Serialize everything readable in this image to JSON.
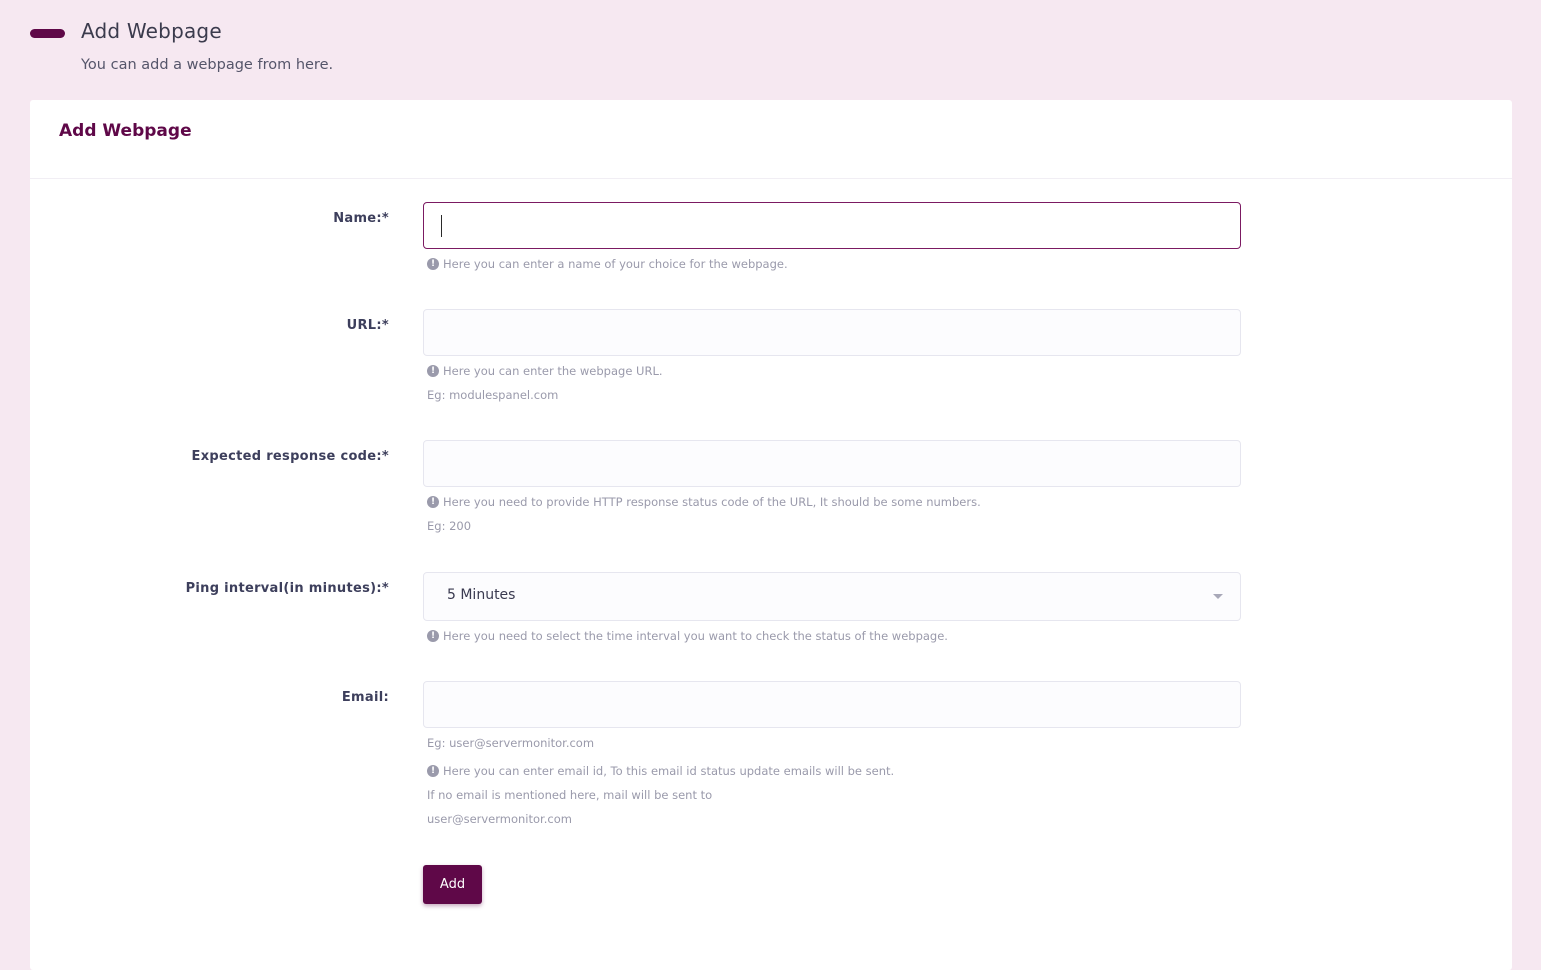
{
  "page_header": {
    "title": "Add Webpage",
    "subtitle": "You can add a webpage from here."
  },
  "card": {
    "title": "Add Webpage"
  },
  "form": {
    "name": {
      "label": "Name:*",
      "value": "",
      "help": "Here you can enter a name of your choice for the webpage."
    },
    "url": {
      "label": "URL:*",
      "value": "",
      "help": "Here you can enter the webpage URL.",
      "example": "Eg: modulespanel.com"
    },
    "response_code": {
      "label": "Expected response code:*",
      "value": "",
      "help": "Here you need to provide HTTP response status code of the URL, It should be some numbers.",
      "example": "Eg: 200"
    },
    "ping_interval": {
      "label": "Ping interval(in minutes):*",
      "selected": "5 Minutes",
      "help": "Here you need to select the time interval you want to check the status of the webpage."
    },
    "email": {
      "label": "Email:",
      "value": "",
      "example": "Eg: user@servermonitor.com",
      "help": "Here you can enter email id, To this email id status update emails will be sent.",
      "help_line2": "If no email is mentioned here, mail will be sent to",
      "help_line3": "user@servermonitor.com"
    },
    "submit_label": "Add"
  },
  "colors": {
    "accent": "#5f0848",
    "page_background": "#f6e8f1",
    "help_text": "#9a9aab"
  },
  "icons": {
    "help": "info-circle-icon"
  }
}
